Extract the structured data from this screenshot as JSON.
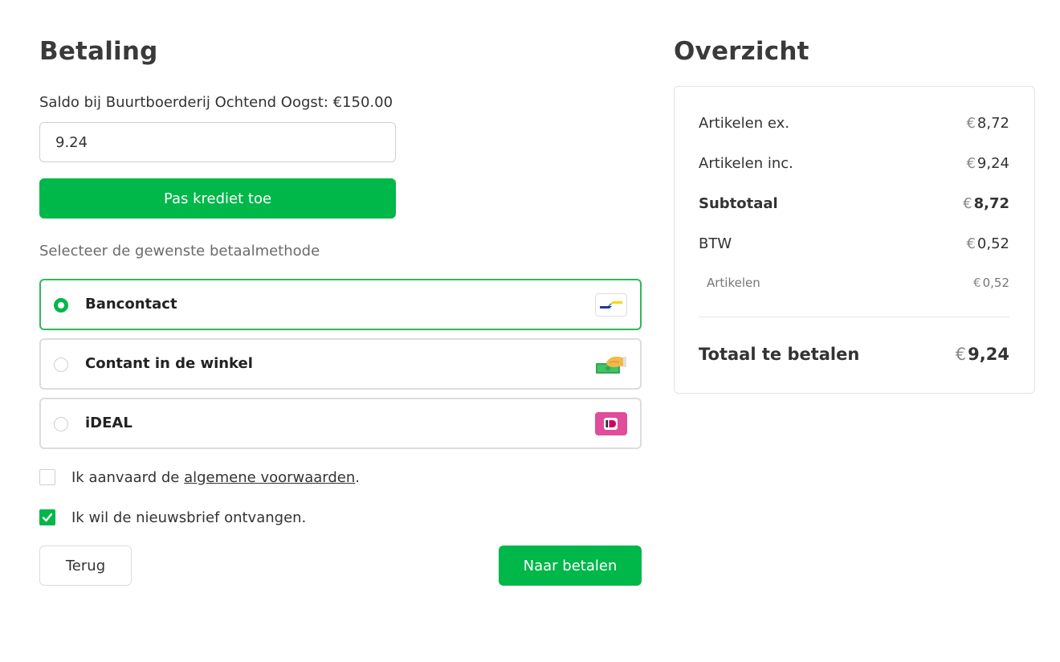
{
  "payment": {
    "title": "Betaling",
    "balance_label": "Saldo bij Buurtboerderij Ochtend Oogst: €150.00",
    "credit_input_value": "9.24",
    "apply_credit_label": "Pas krediet toe",
    "method_prompt": "Selecteer de gewenste betaalmethode",
    "methods": [
      {
        "label": "Bancontact",
        "selected": true,
        "icon": "bancontact-logo"
      },
      {
        "label": "Contant in de winkel",
        "selected": false,
        "icon": "cash-hand-icon"
      },
      {
        "label": "iDEAL",
        "selected": false,
        "icon": "ideal-logo"
      }
    ],
    "terms": {
      "prefix": "Ik aanvaard de ",
      "link": "algemene voorwaarden",
      "suffix": ".",
      "checked": false
    },
    "newsletter": {
      "label": "Ik wil de nieuwsbrief ontvangen.",
      "checked": true
    },
    "back_label": "Terug",
    "pay_label": "Naar betalen"
  },
  "summary": {
    "title": "Overzicht",
    "currency": "€",
    "rows": [
      {
        "label": "Artikelen ex.",
        "amount": "8,72"
      },
      {
        "label": "Artikelen inc.",
        "amount": "9,24"
      },
      {
        "label": "Subtotaal",
        "amount": "8,72"
      },
      {
        "label": "BTW",
        "amount": "0,52"
      },
      {
        "label": "Artikelen",
        "amount": "0,52"
      }
    ],
    "total": {
      "label": "Totaal te betalen",
      "amount": "9,24"
    }
  },
  "colors": {
    "accent": "#00b74a",
    "text": "#333333",
    "muted": "#6b6b6b",
    "border": "#dcdcdc"
  }
}
